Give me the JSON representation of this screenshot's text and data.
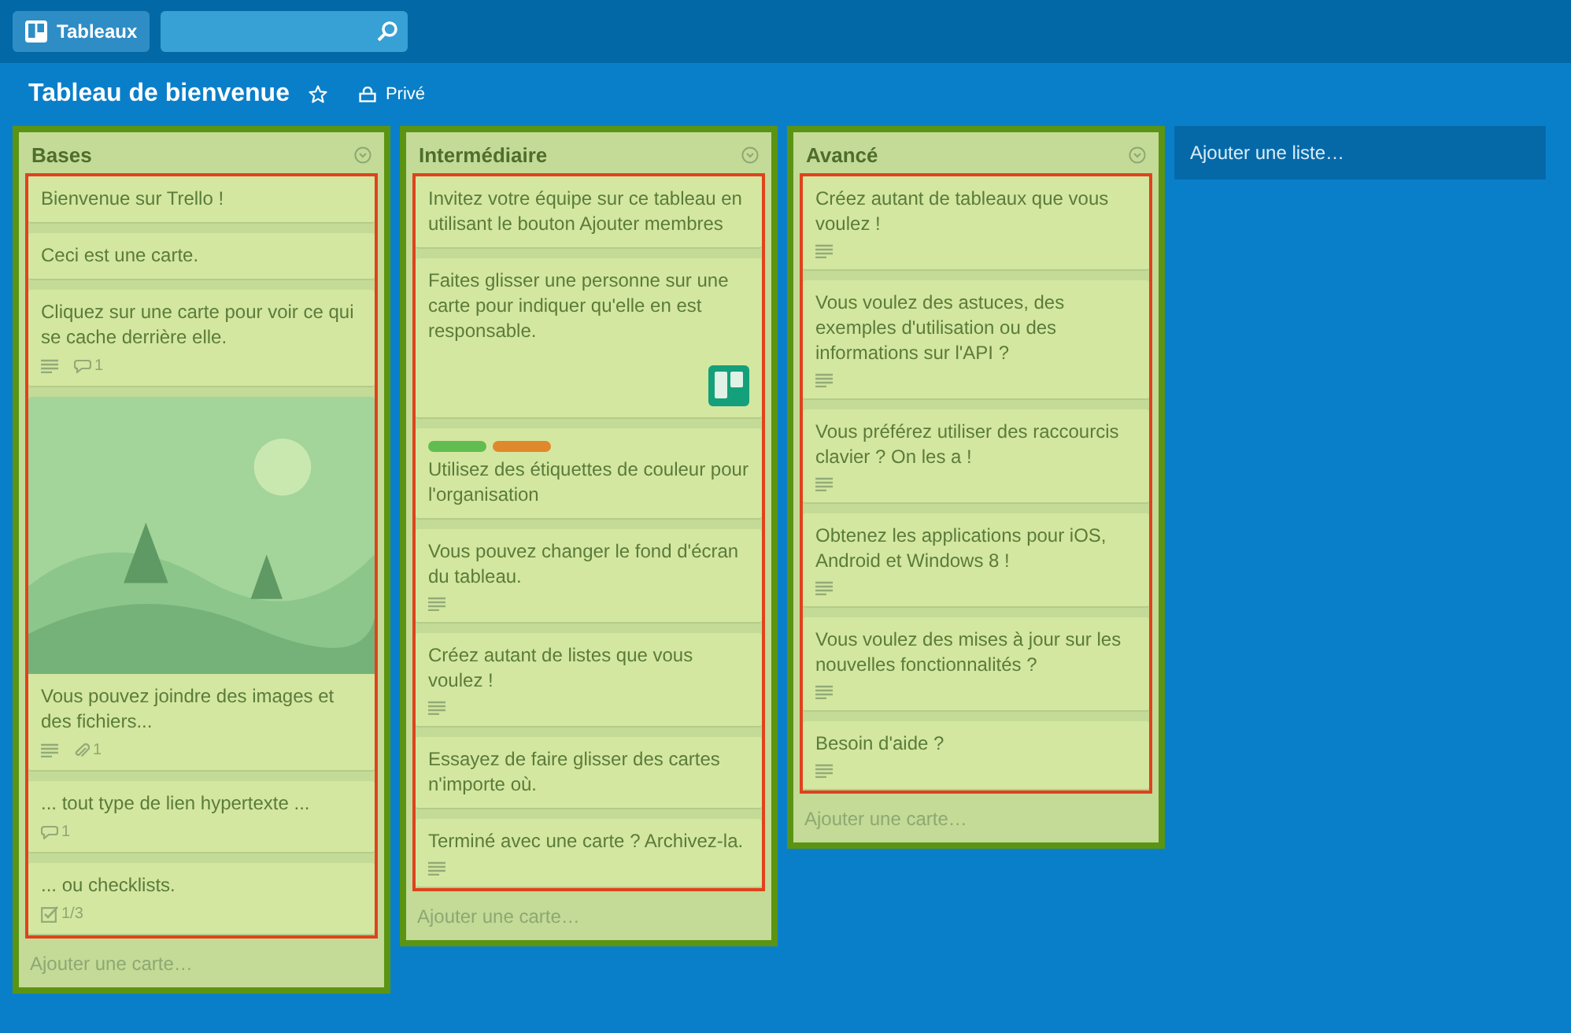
{
  "topbar": {
    "boards_button": "Tableaux"
  },
  "board": {
    "title": "Tableau de bienvenue",
    "starred": false,
    "visibility": "Privé"
  },
  "lists": [
    {
      "title": "Bases",
      "add_card": "Ajouter une carte…",
      "cards": [
        {
          "text": "Bienvenue sur Trello !"
        },
        {
          "text": "Ceci est une carte."
        },
        {
          "text": "Cliquez sur une carte pour voir ce qui se cache derrière elle.",
          "badges": [
            {
              "kind": "description"
            },
            {
              "kind": "comments",
              "count": "1"
            }
          ]
        },
        {
          "cover": {
            "kind": "picture"
          },
          "text": "Vous pouvez joindre des images et des fichiers...",
          "badges": [
            {
              "kind": "description"
            },
            {
              "kind": "attachments",
              "count": "1"
            }
          ]
        },
        {
          "text": "... tout type de lien hypertexte ...",
          "badges": [
            {
              "kind": "comments",
              "count": "1"
            }
          ]
        },
        {
          "text": "... ou checklists.",
          "badges": [
            {
              "kind": "checklist",
              "count": "1/3"
            }
          ]
        }
      ]
    },
    {
      "title": "Intermédiaire",
      "add_card": "Ajouter une carte…",
      "cards": [
        {
          "text": "Invitez votre équipe sur ce tableau en utilisant le bouton Ajouter membres"
        },
        {
          "text": "Faites glisser une personne sur une carte pour indiquer qu'elle en est responsable.",
          "member": true
        },
        {
          "labels": [
            {
              "color": "#61bd4f"
            },
            {
              "color": "#e0882c"
            }
          ],
          "text": "Utilisez des étiquettes de couleur pour l'organisation"
        },
        {
          "text": "Vous pouvez changer le fond d'écran du tableau.",
          "badges": [
            {
              "kind": "description"
            }
          ]
        },
        {
          "text": "Créez autant de listes que vous voulez !",
          "badges": [
            {
              "kind": "description"
            }
          ]
        },
        {
          "text": "Essayez de faire glisser des cartes n'importe où."
        },
        {
          "text": "Terminé avec une carte ? Archivez-la.",
          "badges": [
            {
              "kind": "description"
            }
          ]
        }
      ]
    },
    {
      "title": "Avancé",
      "add_card": "Ajouter une carte…",
      "cards": [
        {
          "text": "Créez autant de tableaux que vous voulez !",
          "badges": [
            {
              "kind": "description"
            }
          ]
        },
        {
          "text": "Vous voulez des astuces, des exemples d'utilisation ou des informations sur l'API ?",
          "badges": [
            {
              "kind": "description"
            }
          ]
        },
        {
          "text": "Vous préférez utiliser des raccourcis clavier ? On les a !",
          "badges": [
            {
              "kind": "description"
            }
          ]
        },
        {
          "text": "Obtenez les applications pour iOS, Android et Windows 8 !",
          "badges": [
            {
              "kind": "description"
            }
          ]
        },
        {
          "text": "Vous voulez des mises à jour sur les nouvelles fonctionnalités ?",
          "badges": [
            {
              "kind": "description"
            }
          ]
        },
        {
          "text": "Besoin d'aide ?",
          "badges": [
            {
              "kind": "description"
            }
          ]
        }
      ]
    }
  ],
  "add_list": "Ajouter une liste…"
}
